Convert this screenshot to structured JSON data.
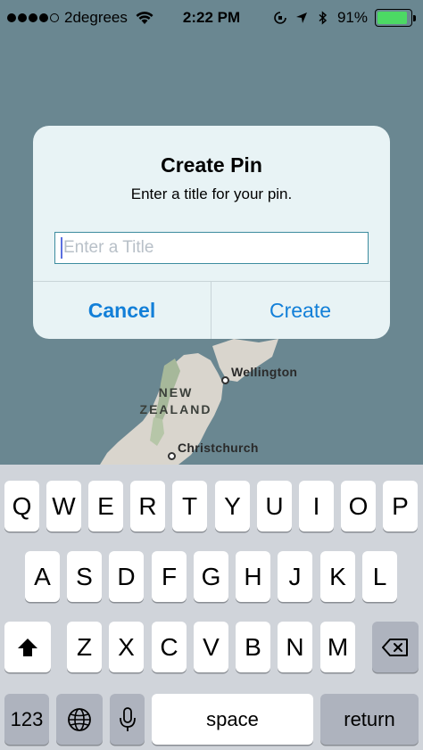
{
  "status_bar": {
    "carrier": "2degrees",
    "time": "2:22 PM",
    "battery_percent": "91%",
    "battery_level": 0.91,
    "signal_bars": 4,
    "signal_max": 5
  },
  "map": {
    "cities": [
      {
        "name": "Wellington"
      },
      {
        "name": "Christchurch"
      }
    ],
    "country": "NEW\nZEALAND"
  },
  "alert": {
    "title": "Create Pin",
    "message": "Enter a title for your pin.",
    "input_value": "",
    "input_placeholder": "Enter a Title",
    "cancel_label": "Cancel",
    "create_label": "Create",
    "accent_color": "#127fd8"
  },
  "keyboard": {
    "row1": [
      "Q",
      "W",
      "E",
      "R",
      "T",
      "Y",
      "U",
      "I",
      "O",
      "P"
    ],
    "row2": [
      "A",
      "S",
      "D",
      "F",
      "G",
      "H",
      "J",
      "K",
      "L"
    ],
    "row3": [
      "Z",
      "X",
      "C",
      "V",
      "B",
      "N",
      "M"
    ],
    "numbers_label": "123",
    "space_label": "space",
    "return_label": "return"
  }
}
